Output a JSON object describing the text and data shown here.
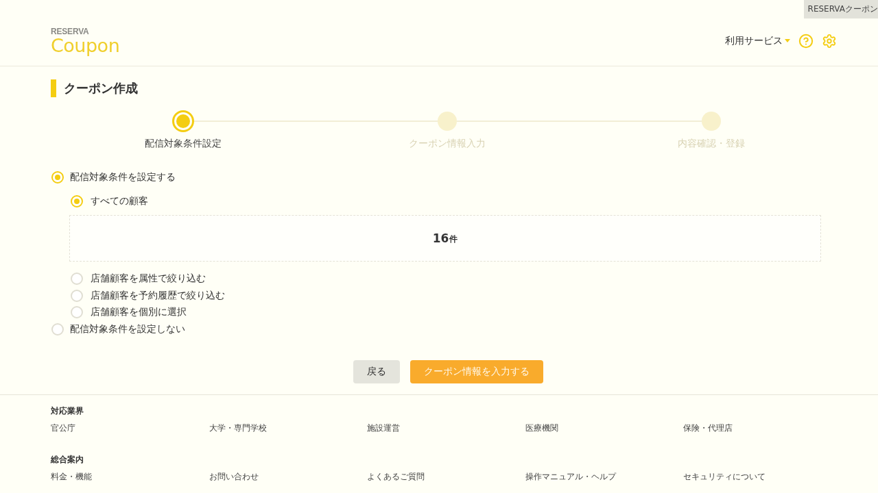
{
  "corner_tab": "RESERVAクーポン",
  "header": {
    "logo": {
      "brand": "RESERVA",
      "product": "Coupon"
    },
    "menu": {
      "label": "利用サービス"
    }
  },
  "page_title": "クーポン作成",
  "steps": [
    {
      "label": "配信対象条件設定",
      "selected": true
    },
    {
      "label": "クーポン情報入力",
      "selected": false
    },
    {
      "label": "内容確認・登録",
      "selected": false
    }
  ],
  "options": [
    {
      "label": "配信対象条件を設定する",
      "selected": true,
      "children": [
        {
          "label": "すべての顧客",
          "selected": true,
          "result": {
            "count": "16",
            "unit": "件"
          }
        },
        {
          "label": "店舗顧客を属性で絞り込む",
          "selected": false
        },
        {
          "label": "店舗顧客を予約履歴で絞り込む",
          "selected": false
        },
        {
          "label": "店舗顧客を個別に選択",
          "selected": false
        }
      ]
    },
    {
      "label": "配信対象条件を設定しない",
      "selected": false
    }
  ],
  "buttons": [
    {
      "label": "戻る",
      "kind": "secondary"
    },
    {
      "label": "クーポン情報を入力する",
      "kind": "primary"
    }
  ],
  "footer": {
    "sections": [
      {
        "title": "対応業界",
        "links": [
          "官公庁",
          "大学・専門学校",
          "施設運営",
          "医療機関",
          "保険・代理店"
        ]
      },
      {
        "title": "総合案内",
        "links": [
          "料金・機能",
          "お問い合わせ",
          "よくあるご質問",
          "操作マニュアル・ヘルプ",
          "セキュリティについて"
        ]
      }
    ]
  }
}
